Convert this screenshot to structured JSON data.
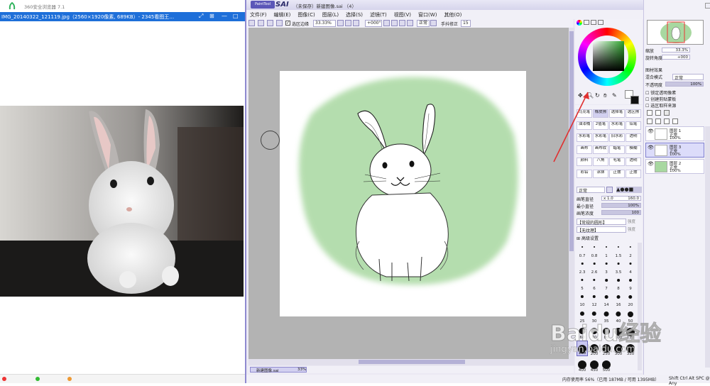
{
  "viewer": {
    "app_title": "360安全浏览器 7.1",
    "image_title": "IMG_20140322_121119.jpg（2560×1920像素, 689KB）- 2345看图王…",
    "taskbar_items": [
      "…",
      "…",
      "…"
    ]
  },
  "sai": {
    "logo": "SAI",
    "window_title": "（未保存）新建图像.sai （4）",
    "menu": [
      "文件(F)",
      "编辑(E)",
      "图像(C)",
      "图层(L)",
      "选择(S)",
      "滤镜(T)",
      "视图(V)",
      "窗口(W)",
      "其他(O)"
    ],
    "toolbar": {
      "antialias_label": "选区边缘",
      "zoom": "33.33%",
      "angle": "+000°",
      "blend": "正常",
      "stabilizer_label": "手抖修正",
      "stabilizer": "15"
    },
    "nav": {
      "zoom_label": "缩放",
      "zoom_value": "33.3%",
      "rotate_label": "旋转角度",
      "rotate_value": "+000"
    },
    "layer_props": {
      "effect_label": "图材效果",
      "blend_label": "混合模式",
      "blend_value": "正常",
      "opacity_label": "不透明度",
      "opacity_value": "100%",
      "check1": "锁定透明像素",
      "check2": "创建剪贴蒙板",
      "check3": "选区取样来源"
    },
    "layers": [
      {
        "name": "图层 1",
        "mode": "正常",
        "opacity": "100%"
      },
      {
        "name": "图层 3",
        "mode": "正常",
        "opacity": "100%"
      },
      {
        "name": "图层 2",
        "mode": "正常",
        "opacity": "100%"
      }
    ],
    "tools": [
      [
        "马克笔",
        "橡皮擦",
        "选择笔",
        "选区擦"
      ],
      [
        "油漆桶",
        "2值笔",
        "水彩笔",
        "铅笔"
      ],
      [
        "水彩笔",
        "水彩笔",
        "旧水彩",
        "透明"
      ],
      [
        "画布",
        "画布纹",
        "蜡笔",
        "模糊"
      ],
      [
        "颜料",
        "八角",
        "毛笔",
        "透明"
      ],
      [
        "彩铅",
        "涂抹",
        "正摆",
        "正摆"
      ]
    ],
    "brush": {
      "mode": "正常",
      "size_label": "画笔直径",
      "size_mult": "x 1.0",
      "size_value": "160.0",
      "min_label": "最小直径",
      "min_value": "100%",
      "density_label": "画笔浓度",
      "density_value": "100",
      "shape1": "【常规的圆形】",
      "shape1_strength": "强度",
      "shape2": "【无纹理】",
      "shape2_strength": "强度",
      "advanced": "高级设置",
      "sizes": [
        "0.7",
        "0.8",
        "1",
        "1.5",
        "2",
        "2.3",
        "2.6",
        "3",
        "3.5",
        "4",
        "5",
        "6",
        "7",
        "8",
        "9",
        "10",
        "12",
        "14",
        "16",
        "20",
        "25",
        "30",
        "35",
        "40",
        "50",
        "60",
        "70",
        "80",
        "100",
        "120",
        "160",
        "200",
        "250",
        "300",
        "350",
        "400",
        "450",
        "500"
      ]
    },
    "doc_tab": {
      "name": "新建图像.sai",
      "zoom": "33%"
    },
    "status": "内存使用率 56%（已用 187MB / 可用 1395MB）",
    "status_right": "Shift Ctrl Alt SPC @ Any"
  },
  "watermark": {
    "brand": "Baidu经验",
    "url": "jingyan.baidu.com"
  },
  "colors": {
    "accent_blue": "#1e6fd9",
    "sai_border": "#8f8ad0",
    "green_wash": "#a8d8a0",
    "arrow_red": "#e03030"
  }
}
